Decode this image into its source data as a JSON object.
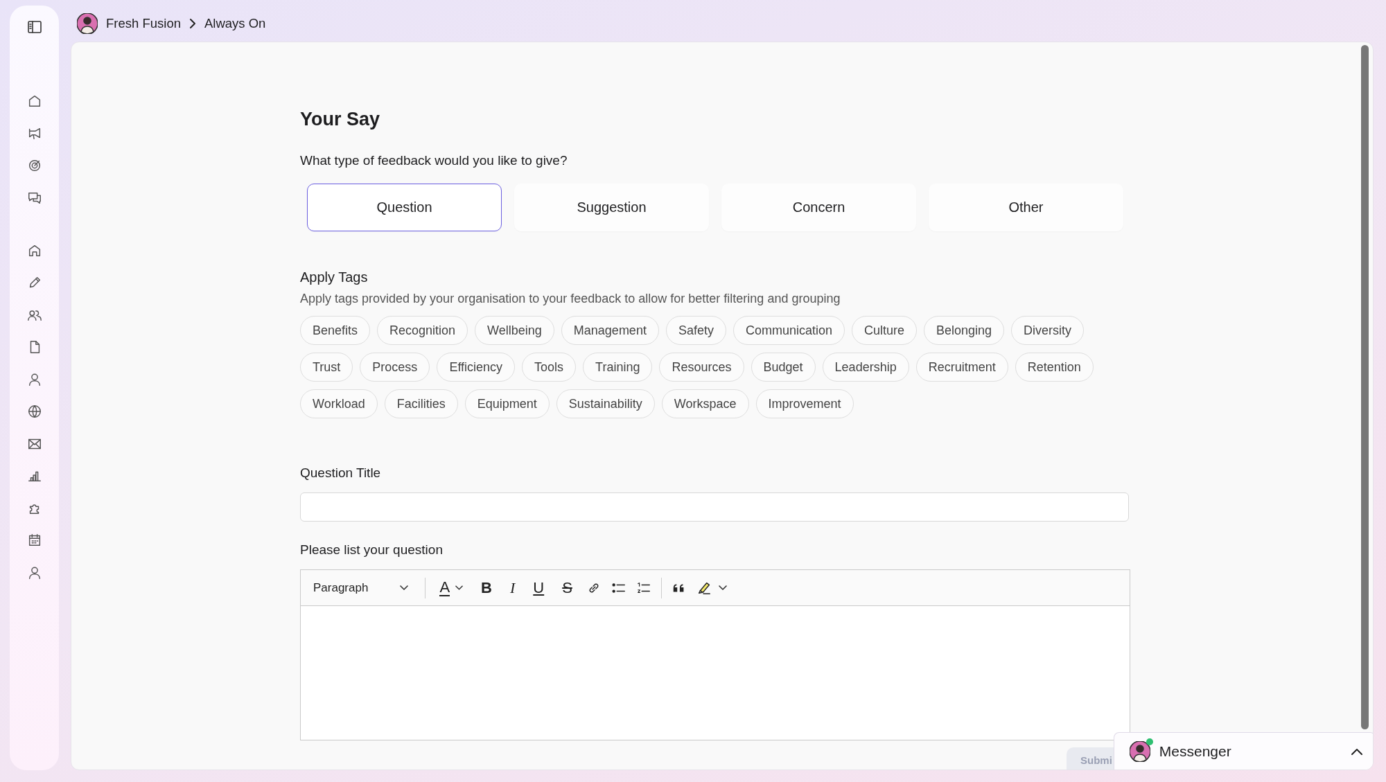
{
  "breadcrumb": [
    "Fresh Fusion",
    "Always On"
  ],
  "form": {
    "title": "Your Say",
    "type_question": "What type of feedback would you like to give?",
    "types": [
      {
        "label": "Question",
        "selected": true
      },
      {
        "label": "Suggestion",
        "selected": false
      },
      {
        "label": "Concern",
        "selected": false
      },
      {
        "label": "Other",
        "selected": false
      }
    ],
    "tags_heading": "Apply Tags",
    "tags_hint": "Apply tags provided by your organisation to your feedback to allow for better filtering and grouping",
    "tags": [
      "Benefits",
      "Recognition",
      "Wellbeing",
      "Management",
      "Safety",
      "Communication",
      "Culture",
      "Belonging",
      "Diversity",
      "Trust",
      "Process",
      "Efficiency",
      "Tools",
      "Training",
      "Resources",
      "Budget",
      "Leadership",
      "Recruitment",
      "Retention",
      "Workload",
      "Facilities",
      "Equipment",
      "Sustainability",
      "Workspace",
      "Improvement"
    ],
    "title_label": "Question Title",
    "body_label": "Please list your question",
    "editor": {
      "block_style": "Paragraph",
      "tools": [
        {
          "kind": "font-color",
          "label": "A"
        },
        {
          "kind": "bold",
          "label": "B"
        },
        {
          "kind": "italic",
          "label": "I"
        },
        {
          "kind": "underline",
          "label": "U"
        },
        {
          "kind": "strikethrough",
          "label": "S"
        },
        {
          "kind": "link"
        },
        {
          "kind": "bullet-list"
        },
        {
          "kind": "numbered-list"
        },
        {
          "kind": "quote"
        },
        {
          "kind": "highlight"
        }
      ]
    },
    "submit_button": "Submi"
  },
  "messenger": {
    "title": "Messenger",
    "online": true
  }
}
